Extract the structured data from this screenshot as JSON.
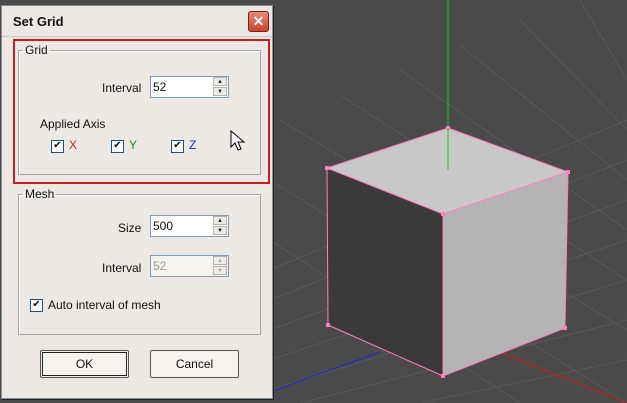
{
  "dialog": {
    "title": "Set Grid",
    "close_label": "✕",
    "grid": {
      "legend": "Grid",
      "interval_label": "Interval",
      "interval_value": "52",
      "applied_axis_label": "Applied Axis",
      "axes": [
        {
          "label": "X",
          "checked": true,
          "color": "#c81e1e"
        },
        {
          "label": "Y",
          "checked": true,
          "color": "#1e8c1e"
        },
        {
          "label": "Z",
          "checked": true,
          "color": "#1e28c8"
        }
      ]
    },
    "mesh": {
      "legend": "Mesh",
      "size_label": "Size",
      "size_value": "500",
      "interval_label": "Interval",
      "interval_value": "52",
      "auto_label": "Auto interval of mesh",
      "auto_checked": true
    },
    "buttons": {
      "ok": "OK",
      "cancel": "Cancel"
    }
  },
  "viewport": {
    "background": "#4a4a4a",
    "grid_line_color": "#5a5a5a",
    "axis_colors": {
      "x": "#c81e1e",
      "y": "#1ec81e",
      "z": "#1e28c8"
    },
    "cube_colors": {
      "top": "#c8c8c8",
      "left": "#3a3a3a",
      "right": "#b4b4b4",
      "edge": "#ff7fbf"
    }
  }
}
